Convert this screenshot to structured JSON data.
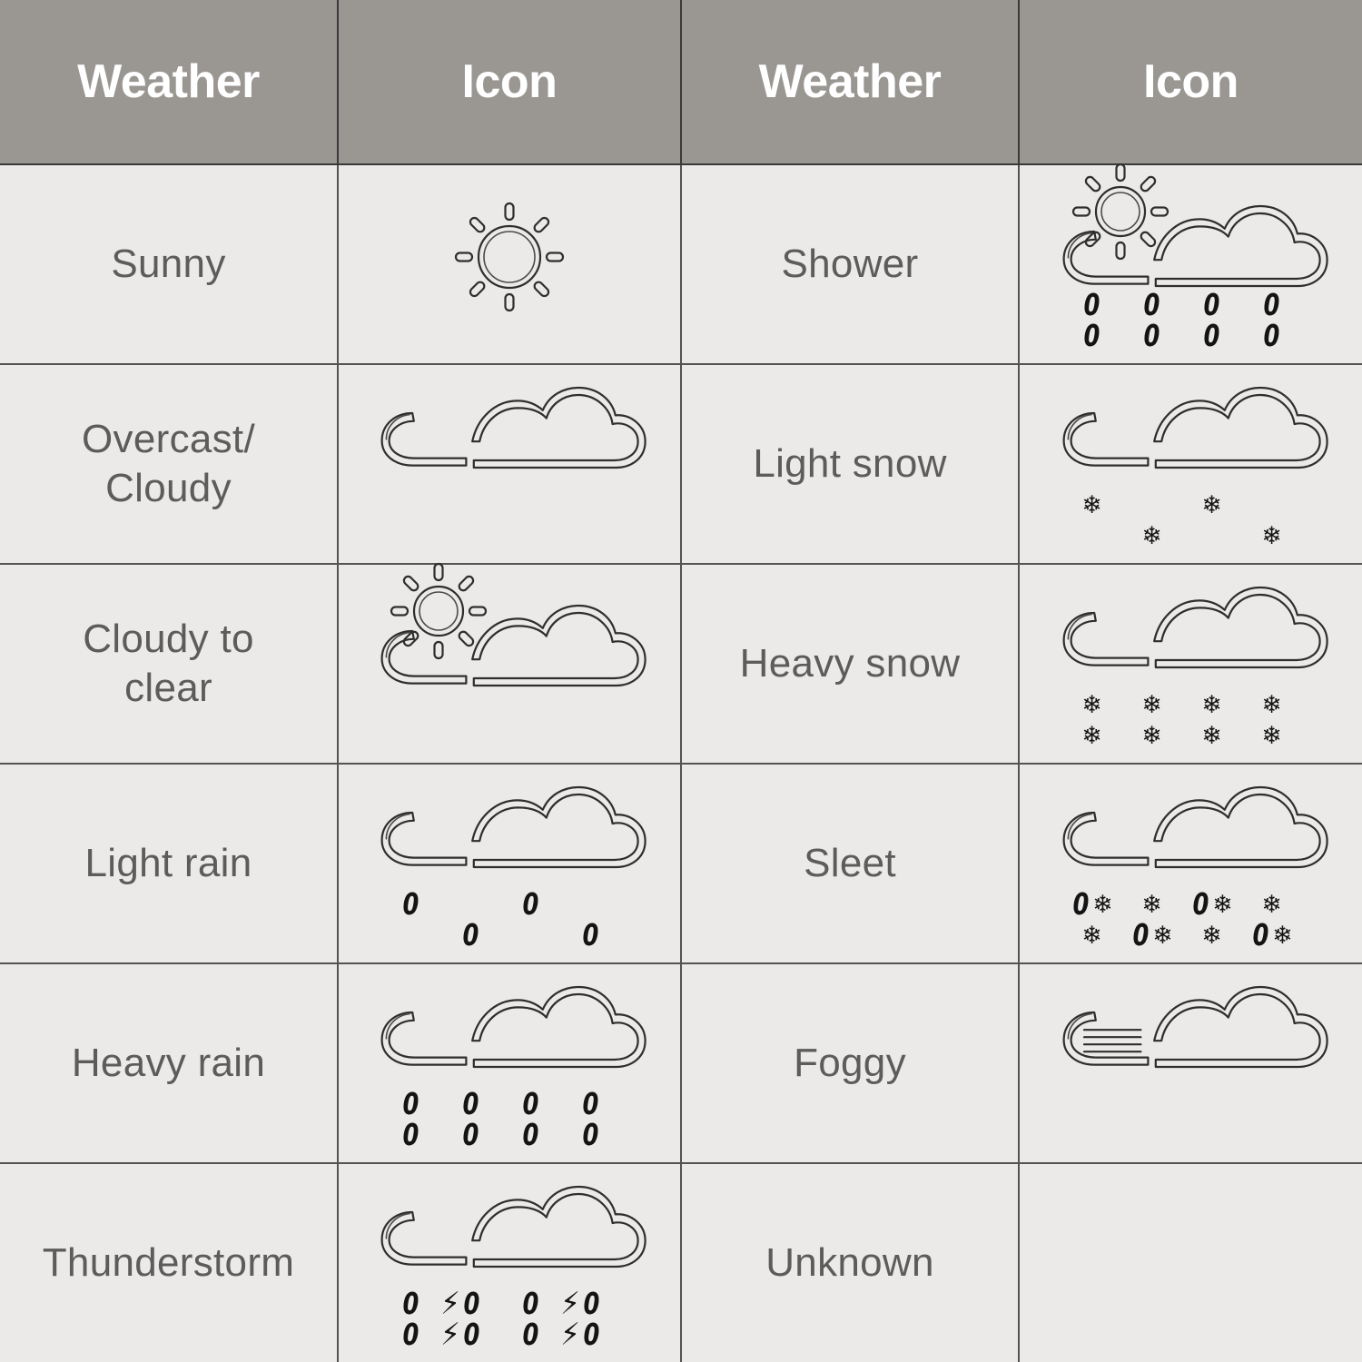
{
  "table": {
    "headers": [
      "Weather",
      "Icon",
      "Weather",
      "Icon"
    ],
    "colors": {
      "header_background": "#9a9692",
      "header_text": "#ffffff",
      "cell_background": "#ebeae8",
      "cell_text": "#5e5c5a",
      "grid_line": "#555252",
      "icon_stroke": "#2e2e2e"
    },
    "rows": [
      {
        "left": {
          "label": "Sunny",
          "label_lines": [
            "Sunny"
          ],
          "icon_name": "sun-icon",
          "icon_parts": [
            "sun"
          ],
          "precipitation": "none"
        },
        "right": {
          "label": "Shower",
          "label_lines": [
            "Shower"
          ],
          "icon_name": "sun-cloud-rain-icon",
          "icon_parts": [
            "sun",
            "cloud-small",
            "cloud-large"
          ],
          "precipitation": "rain-heavy"
        }
      },
      {
        "left": {
          "label": "Overcast/ Cloudy",
          "label_lines": [
            "Overcast/",
            "Cloudy"
          ],
          "icon_name": "cloud-icon",
          "icon_parts": [
            "cloud-small",
            "cloud-large"
          ],
          "precipitation": "none"
        },
        "right": {
          "label": "Light snow",
          "label_lines": [
            "Light snow"
          ],
          "icon_name": "cloud-light-snow-icon",
          "icon_parts": [
            "cloud-small",
            "cloud-large"
          ],
          "precipitation": "snow-light"
        }
      },
      {
        "left": {
          "label": "Cloudy to clear",
          "label_lines": [
            "Cloudy to",
            "clear"
          ],
          "icon_name": "sun-cloud-icon",
          "icon_parts": [
            "sun",
            "cloud-small",
            "cloud-large"
          ],
          "precipitation": "none"
        },
        "right": {
          "label": "Heavy snow",
          "label_lines": [
            "Heavy snow"
          ],
          "icon_name": "cloud-heavy-snow-icon",
          "icon_parts": [
            "cloud-small",
            "cloud-large"
          ],
          "precipitation": "snow-heavy"
        }
      },
      {
        "left": {
          "label": "Light rain",
          "label_lines": [
            "Light rain"
          ],
          "icon_name": "cloud-light-rain-icon",
          "icon_parts": [
            "cloud-small",
            "cloud-large"
          ],
          "precipitation": "rain-light"
        },
        "right": {
          "label": "Sleet",
          "label_lines": [
            "Sleet"
          ],
          "icon_name": "cloud-sleet-icon",
          "icon_parts": [
            "cloud-small",
            "cloud-large"
          ],
          "precipitation": "sleet"
        }
      },
      {
        "left": {
          "label": "Heavy rain",
          "label_lines": [
            "Heavy rain"
          ],
          "icon_name": "cloud-heavy-rain-icon",
          "icon_parts": [
            "cloud-small",
            "cloud-large"
          ],
          "precipitation": "rain-heavy"
        },
        "right": {
          "label": "Foggy",
          "label_lines": [
            "Foggy"
          ],
          "icon_name": "cloud-fog-icon",
          "icon_parts": [
            "cloud-small-fog-lines",
            "cloud-large"
          ],
          "precipitation": "none"
        }
      },
      {
        "left": {
          "label": "Thunderstorm",
          "label_lines": [
            "Thunderstorm"
          ],
          "icon_name": "cloud-thunderstorm-icon",
          "icon_parts": [
            "cloud-small",
            "cloud-large"
          ],
          "precipitation": "thunderstorm"
        },
        "right": {
          "label": "Unknown",
          "label_lines": [
            "Unknown"
          ],
          "icon_name": "no-icon",
          "icon_parts": [],
          "precipitation": "none"
        }
      }
    ]
  },
  "glyphs": {
    "raindrop": "0",
    "snowflake": "❄",
    "lightning": "⚡"
  }
}
